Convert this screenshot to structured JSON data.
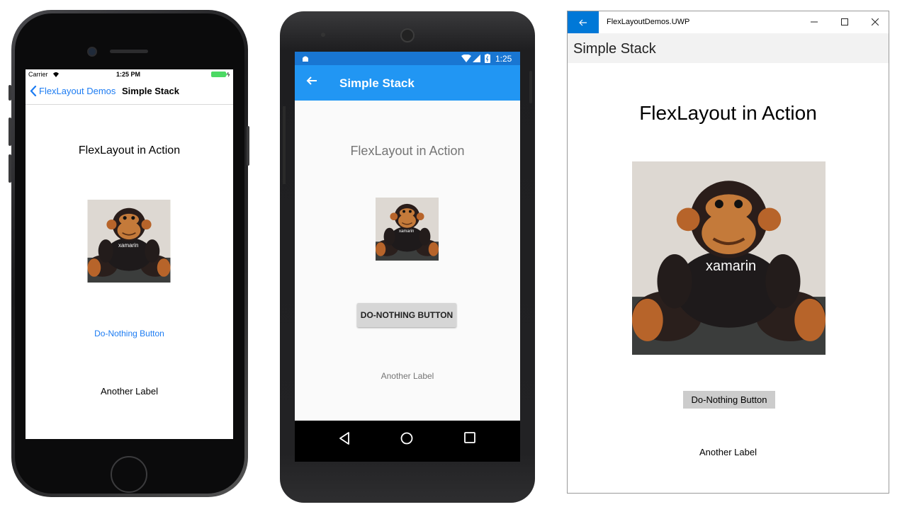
{
  "ios": {
    "status": {
      "carrier": "Carrier",
      "time": "1:25 PM"
    },
    "nav": {
      "back_label": "FlexLayout Demos",
      "title": "Simple Stack"
    },
    "heading": "FlexLayout in Action",
    "image_text": "xamarin",
    "button_label": "Do-Nothing Button",
    "label": "Another Label"
  },
  "android": {
    "status": {
      "time": "1:25"
    },
    "appbar": {
      "title": "Simple Stack"
    },
    "heading": "FlexLayout in Action",
    "image_text": "xamarin",
    "button_label": "DO-NOTHING BUTTON",
    "label": "Another Label",
    "colors": {
      "status": "#1976d2",
      "appbar": "#2196f3"
    }
  },
  "uwp": {
    "window_title": "FlexLayoutDemos.UWP",
    "page_header": "Simple Stack",
    "heading": "FlexLayout in Action",
    "image_text": "xamarin",
    "button_label": "Do-Nothing Button",
    "label": "Another Label",
    "colors": {
      "accent": "#0078d7"
    }
  }
}
